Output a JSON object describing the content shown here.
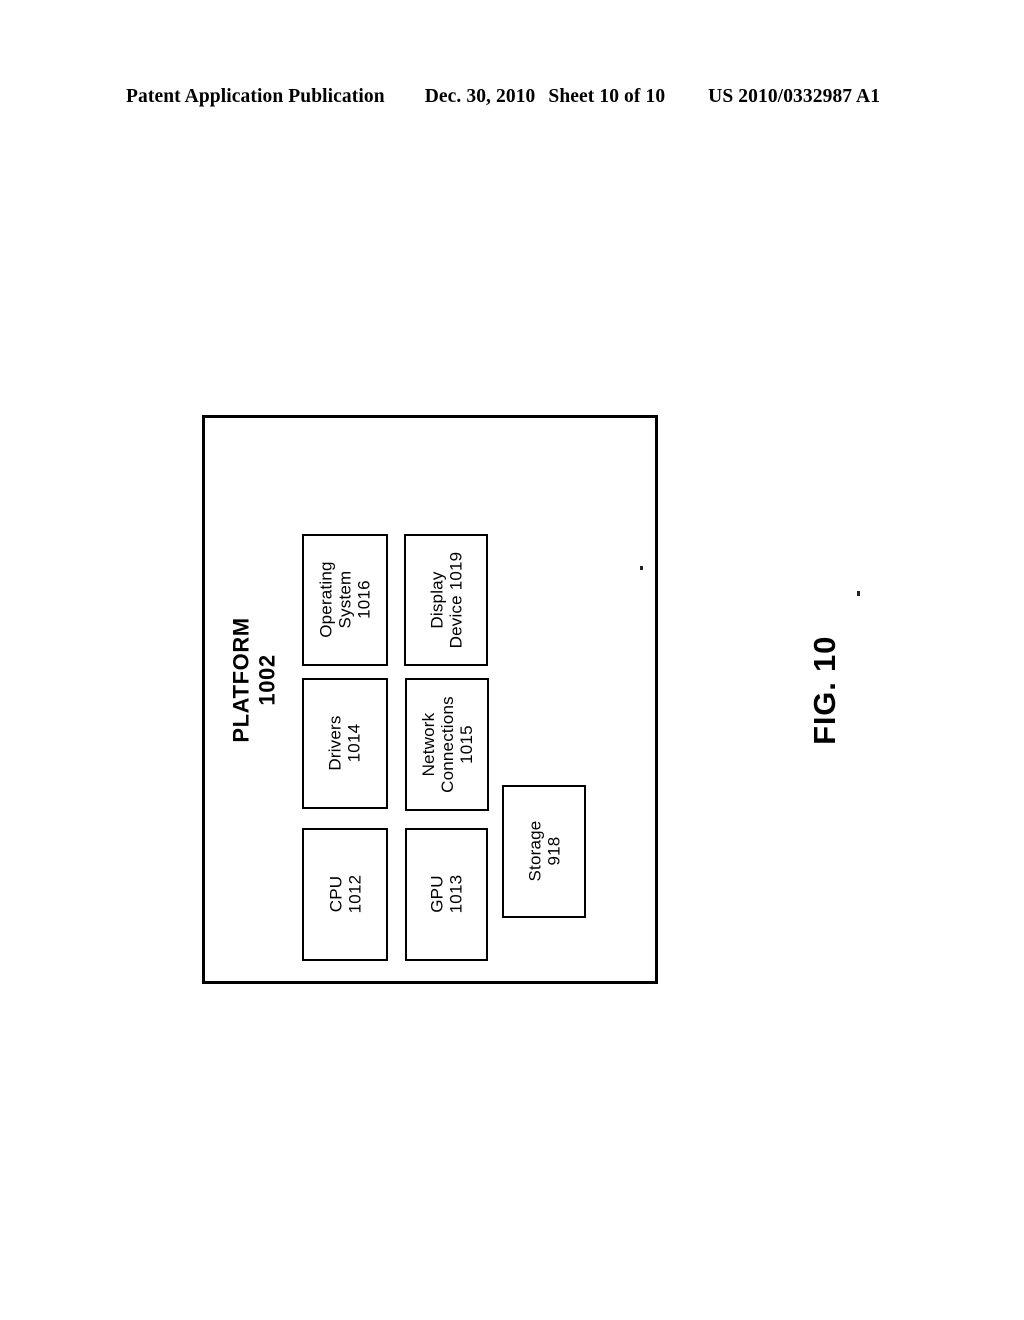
{
  "header": {
    "publication": "Patent Application Publication",
    "date": "Dec. 30, 2010",
    "sheet": "Sheet 10 of 10",
    "publication_number": "US 2010/0332987 A1"
  },
  "figure": {
    "caption": "FIG. 10",
    "platform": {
      "title": "PLATFORM",
      "reference_numeral": "1002"
    },
    "components": [
      {
        "id": "cpu",
        "name": "CPU",
        "reference_numeral": "1012"
      },
      {
        "id": "gpu",
        "name": "GPU",
        "reference_numeral": "1013"
      },
      {
        "id": "drivers",
        "name": "Drivers",
        "reference_numeral": "1014"
      },
      {
        "id": "network",
        "name": "Network Connections",
        "reference_numeral": "1015"
      },
      {
        "id": "os",
        "name": "Operating System",
        "reference_numeral": "1016"
      },
      {
        "id": "display",
        "name": "Display Device 1019",
        "reference_numeral": ""
      },
      {
        "id": "storage",
        "name": "Storage",
        "reference_numeral": "918"
      }
    ],
    "labels": {
      "cpu_line1": "CPU",
      "cpu_line2": "1012",
      "gpu_line1": "GPU",
      "gpu_line2": "1013",
      "drivers_line1": "Drivers",
      "drivers_line2": "1014",
      "network_line1": "Network",
      "network_line2": "Connections",
      "network_line3": "1015",
      "os_line1": "Operating",
      "os_line2": "System",
      "os_line3": "1016",
      "display_line1": "Display",
      "display_line2": "Device 1019",
      "storage_line1": "Storage",
      "storage_line2": "918",
      "platform_line1": "PLATFORM",
      "platform_line2": "1002"
    }
  },
  "colors": {
    "ink": "#000000",
    "paper": "#ffffff"
  }
}
